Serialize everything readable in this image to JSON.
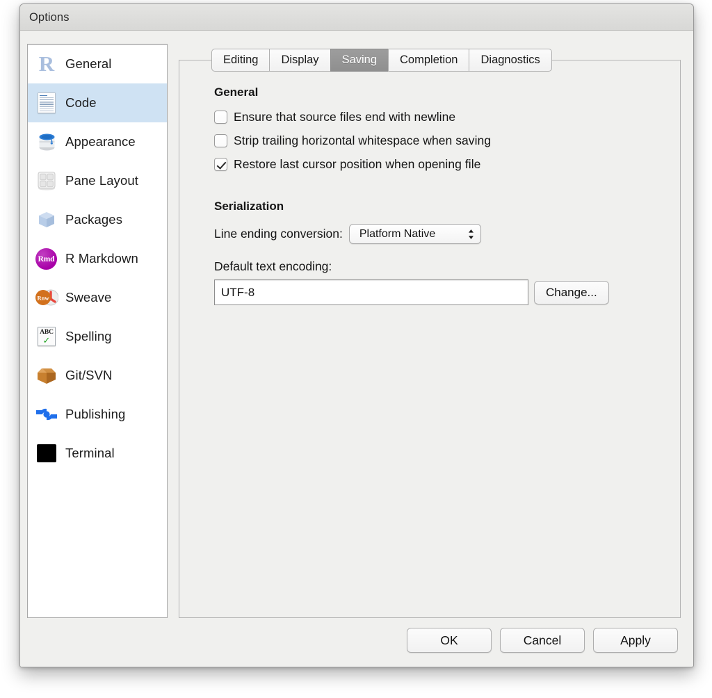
{
  "window": {
    "title": "Options"
  },
  "sidebar": {
    "items": [
      {
        "label": "General",
        "icon": "r-logo-icon",
        "selected": false
      },
      {
        "label": "Code",
        "icon": "code-document-icon",
        "selected": true
      },
      {
        "label": "Appearance",
        "icon": "paint-can-icon",
        "selected": false
      },
      {
        "label": "Pane Layout",
        "icon": "pane-grid-icon",
        "selected": false
      },
      {
        "label": "Packages",
        "icon": "cube-icon",
        "selected": false
      },
      {
        "label": "R Markdown",
        "icon": "rmd-badge-icon",
        "selected": false
      },
      {
        "label": "Sweave",
        "icon": "sweave-rnw-pdf-icon",
        "selected": false
      },
      {
        "label": "Spelling",
        "icon": "abc-check-icon",
        "selected": false
      },
      {
        "label": "Git/SVN",
        "icon": "package-box-icon",
        "selected": false
      },
      {
        "label": "Publishing",
        "icon": "publishing-icon",
        "selected": false
      },
      {
        "label": "Terminal",
        "icon": "terminal-icon",
        "selected": false
      }
    ]
  },
  "tabs": [
    {
      "label": "Editing",
      "active": false
    },
    {
      "label": "Display",
      "active": false
    },
    {
      "label": "Saving",
      "active": true
    },
    {
      "label": "Completion",
      "active": false
    },
    {
      "label": "Diagnostics",
      "active": false
    }
  ],
  "general_section": {
    "heading": "General",
    "checkboxes": [
      {
        "label": "Ensure that source files end with newline",
        "checked": false
      },
      {
        "label": "Strip trailing horizontal whitespace when saving",
        "checked": false
      },
      {
        "label": "Restore last cursor position when opening file",
        "checked": true
      }
    ]
  },
  "serialization_section": {
    "heading": "Serialization",
    "line_ending_label": "Line ending conversion:",
    "line_ending_value": "Platform Native",
    "line_ending_options": [
      "Platform Native"
    ],
    "encoding_label": "Default text encoding:",
    "encoding_value": "UTF-8",
    "change_button": "Change..."
  },
  "footer": {
    "ok": "OK",
    "cancel": "Cancel",
    "apply": "Apply"
  },
  "colors": {
    "selection": "#cfe2f3",
    "active_tab": "#949494",
    "window_bg": "#f0f0ee",
    "titlebar": "#dcdcda"
  }
}
